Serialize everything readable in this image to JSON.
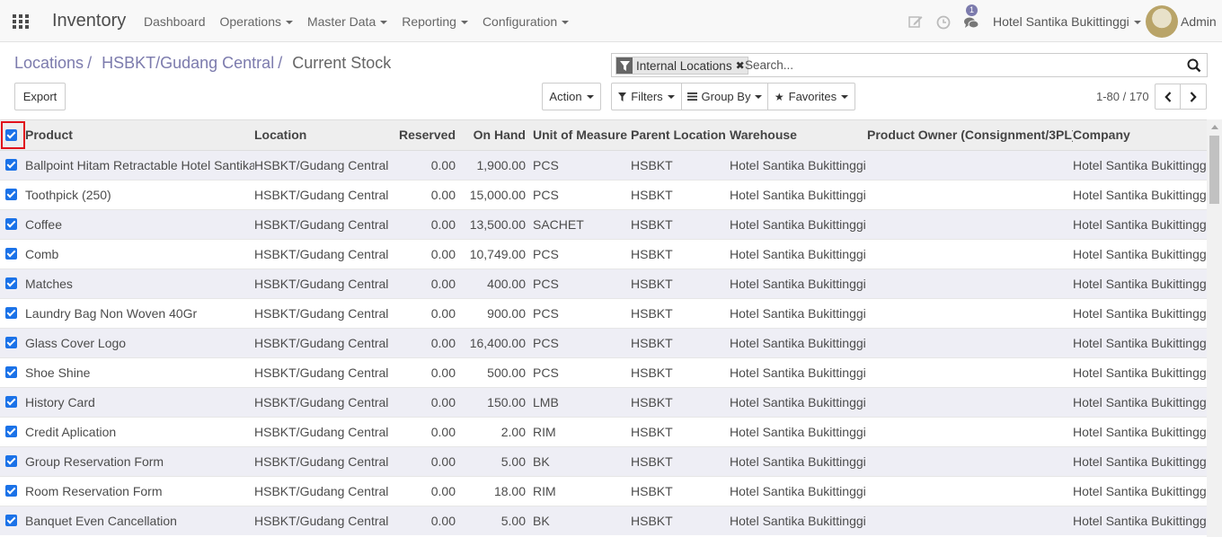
{
  "nav": {
    "app_title": "Inventory",
    "menu": [
      {
        "label": "Dashboard",
        "dropdown": false
      },
      {
        "label": "Operations",
        "dropdown": true
      },
      {
        "label": "Master Data",
        "dropdown": true
      },
      {
        "label": "Reporting",
        "dropdown": true
      },
      {
        "label": "Configuration",
        "dropdown": true
      }
    ],
    "messages_badge": "1",
    "company": "Hotel Santika Bukittinggi",
    "user": "Admin",
    "icons": [
      "apps-grid-icon",
      "edit-icon",
      "clock-icon",
      "chat-icon"
    ]
  },
  "breadcrumb": {
    "items": [
      "Locations",
      "HSBKT/Gudang Central"
    ],
    "current": "Current Stock"
  },
  "search": {
    "facet_label": "Internal Locations",
    "placeholder": "Search..."
  },
  "toolbar": {
    "export": "Export",
    "action": "Action",
    "filters": "Filters",
    "group_by": "Group By",
    "favorites": "Favorites",
    "pager": "1-80 / 170"
  },
  "table": {
    "columns": [
      "Product",
      "Location",
      "Reserved",
      "On Hand",
      "Unit of Measure",
      "Parent Location",
      "Warehouse",
      "Product Owner (Consignment/3PL)",
      "Company"
    ],
    "rows": [
      {
        "product": "Ballpoint Hitam Retractable Hotel Santika",
        "location": "HSBKT/Gudang Central",
        "reserved": "0.00",
        "on_hand": "1,900.00",
        "uom": "PCS",
        "parent": "HSBKT",
        "warehouse": "Hotel Santika Bukittinggi",
        "owner": "",
        "company": "Hotel Santika Bukittinggi"
      },
      {
        "product": "Toothpick (250)",
        "location": "HSBKT/Gudang Central",
        "reserved": "0.00",
        "on_hand": "15,000.00",
        "uom": "PCS",
        "parent": "HSBKT",
        "warehouse": "Hotel Santika Bukittinggi",
        "owner": "",
        "company": "Hotel Santika Bukittinggi"
      },
      {
        "product": "Coffee",
        "location": "HSBKT/Gudang Central",
        "reserved": "0.00",
        "on_hand": "13,500.00",
        "uom": "SACHET",
        "parent": "HSBKT",
        "warehouse": "Hotel Santika Bukittinggi",
        "owner": "",
        "company": "Hotel Santika Bukittinggi"
      },
      {
        "product": "Comb",
        "location": "HSBKT/Gudang Central",
        "reserved": "0.00",
        "on_hand": "10,749.00",
        "uom": "PCS",
        "parent": "HSBKT",
        "warehouse": "Hotel Santika Bukittinggi",
        "owner": "",
        "company": "Hotel Santika Bukittinggi"
      },
      {
        "product": "Matches",
        "location": "HSBKT/Gudang Central",
        "reserved": "0.00",
        "on_hand": "400.00",
        "uom": "PCS",
        "parent": "HSBKT",
        "warehouse": "Hotel Santika Bukittinggi",
        "owner": "",
        "company": "Hotel Santika Bukittinggi"
      },
      {
        "product": "Laundry Bag Non Woven 40Gr",
        "location": "HSBKT/Gudang Central",
        "reserved": "0.00",
        "on_hand": "900.00",
        "uom": "PCS",
        "parent": "HSBKT",
        "warehouse": "Hotel Santika Bukittinggi",
        "owner": "",
        "company": "Hotel Santika Bukittinggi"
      },
      {
        "product": "Glass Cover Logo",
        "location": "HSBKT/Gudang Central",
        "reserved": "0.00",
        "on_hand": "16,400.00",
        "uom": "PCS",
        "parent": "HSBKT",
        "warehouse": "Hotel Santika Bukittinggi",
        "owner": "",
        "company": "Hotel Santika Bukittinggi"
      },
      {
        "product": "Shoe Shine",
        "location": "HSBKT/Gudang Central",
        "reserved": "0.00",
        "on_hand": "500.00",
        "uom": "PCS",
        "parent": "HSBKT",
        "warehouse": "Hotel Santika Bukittinggi",
        "owner": "",
        "company": "Hotel Santika Bukittinggi"
      },
      {
        "product": "History Card",
        "location": "HSBKT/Gudang Central",
        "reserved": "0.00",
        "on_hand": "150.00",
        "uom": "LMB",
        "parent": "HSBKT",
        "warehouse": "Hotel Santika Bukittinggi",
        "owner": "",
        "company": "Hotel Santika Bukittinggi"
      },
      {
        "product": "Credit Aplication",
        "location": "HSBKT/Gudang Central",
        "reserved": "0.00",
        "on_hand": "2.00",
        "uom": "RIM",
        "parent": "HSBKT",
        "warehouse": "Hotel Santika Bukittinggi",
        "owner": "",
        "company": "Hotel Santika Bukittinggi"
      },
      {
        "product": "Group Reservation Form",
        "location": "HSBKT/Gudang Central",
        "reserved": "0.00",
        "on_hand": "5.00",
        "uom": "BK",
        "parent": "HSBKT",
        "warehouse": "Hotel Santika Bukittinggi",
        "owner": "",
        "company": "Hotel Santika Bukittinggi"
      },
      {
        "product": "Room Reservation Form",
        "location": "HSBKT/Gudang Central",
        "reserved": "0.00",
        "on_hand": "18.00",
        "uom": "RIM",
        "parent": "HSBKT",
        "warehouse": "Hotel Santika Bukittinggi",
        "owner": "",
        "company": "Hotel Santika Bukittinggi"
      },
      {
        "product": "Banquet Even Cancellation",
        "location": "HSBKT/Gudang Central",
        "reserved": "0.00",
        "on_hand": "5.00",
        "uom": "BK",
        "parent": "HSBKT",
        "warehouse": "Hotel Santika Bukittinggi",
        "owner": "",
        "company": "Hotel Santika Bukittinggi"
      }
    ]
  },
  "colors": {
    "accent": "#7c7bad",
    "checkbox": "#1b72e8",
    "highlight_box": "#e0101a",
    "odd_row": "#eeeef5"
  }
}
